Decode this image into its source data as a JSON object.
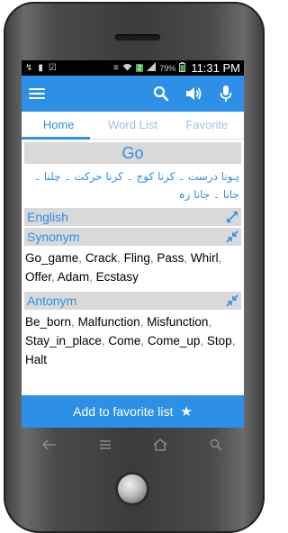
{
  "statusbar": {
    "battery_percent": "79%",
    "signal_badge": "2",
    "time": "11:31 PM"
  },
  "appbar": {
    "icons": [
      "menu-icon",
      "search-icon",
      "speaker-icon",
      "microphone-icon"
    ]
  },
  "tabs": [
    {
      "label": "Home",
      "active": true
    },
    {
      "label": "Word List",
      "active": false
    },
    {
      "label": "Favorite",
      "active": false
    }
  ],
  "word": {
    "title": "Go",
    "urdu_meaning": "ہونا درست ۔ کرنا کوچ ۔ کرنا حرکت ۔ چلنا ۔ جانا ۔ جانا رہ"
  },
  "sections": {
    "english": {
      "label": "English",
      "expanded": false
    },
    "synonym": {
      "label": "Synonym",
      "expanded": true,
      "words": [
        "Go_game",
        "Crack",
        "Fling",
        "Pass",
        "Whirl",
        "Offer",
        "Adam",
        "Ecstasy"
      ]
    },
    "antonym": {
      "label": "Antonym",
      "expanded": true,
      "words": [
        "Be_born",
        "Malfunction",
        "Misfunction",
        "Stay_in_place",
        "Come",
        "Come_up",
        "Stop",
        "Halt"
      ]
    }
  },
  "favorite_button": {
    "label": "Add to favorite list",
    "icon": "star-icon"
  },
  "colors": {
    "accent": "#2e8fe6",
    "section_bg": "#d9d9d9",
    "tab_inactive": "#9bc3eb"
  }
}
